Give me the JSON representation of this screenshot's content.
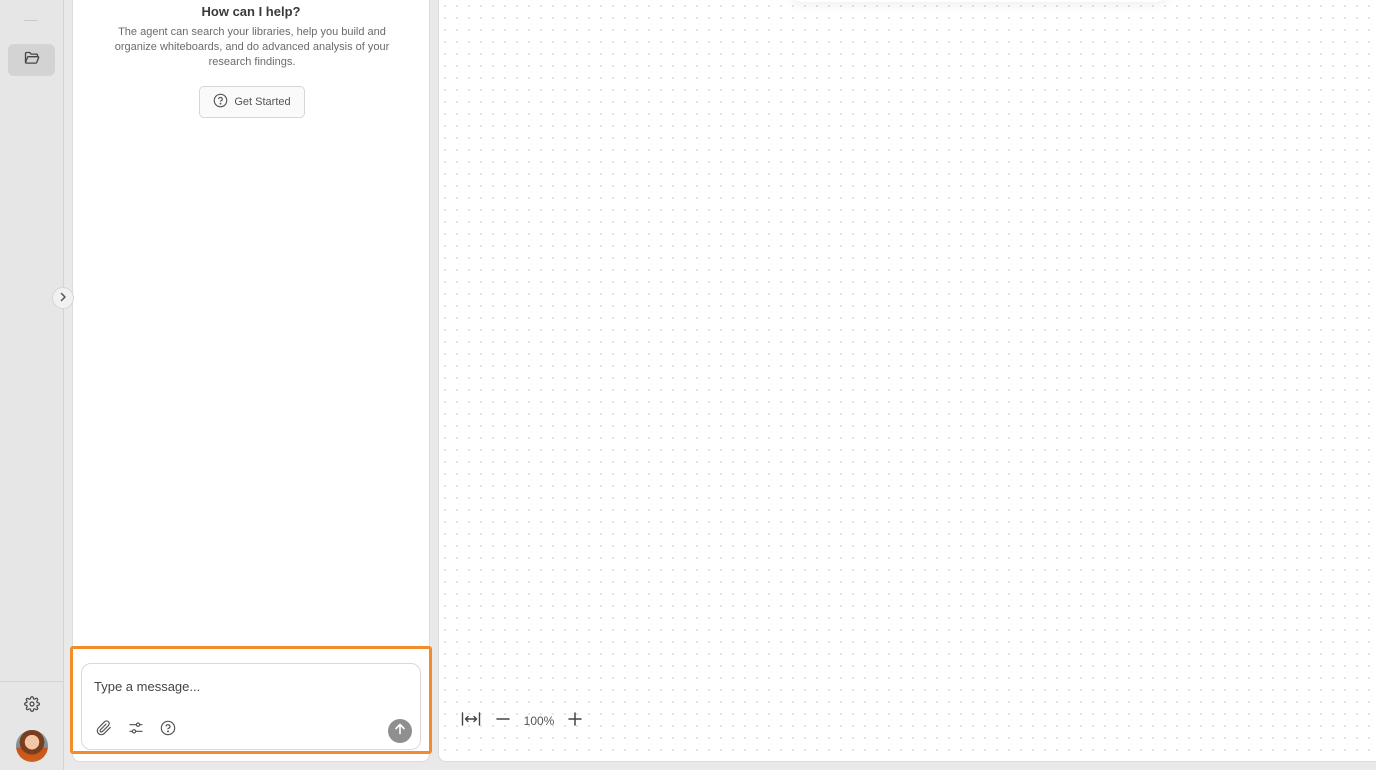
{
  "rail": {
    "folder_icon": "folder-open-icon",
    "settings_icon": "gear-icon",
    "avatar": "user-avatar"
  },
  "chat": {
    "help_title": "How can I help?",
    "help_description": "The agent can search your libraries, help you build and organize whiteboards, and do advanced analysis of your research findings.",
    "get_started_label": "Get Started",
    "composer": {
      "placeholder": "Type a message...",
      "icons": [
        "paperclip-icon",
        "sliders-icon",
        "help-circle-icon",
        "send-arrow-icon"
      ]
    },
    "highlight_color": "#f28c28"
  },
  "canvas": {
    "zoom_level": "100%",
    "controls": [
      "fit-width-icon",
      "zoom-out-icon",
      "zoom-in-icon"
    ]
  }
}
